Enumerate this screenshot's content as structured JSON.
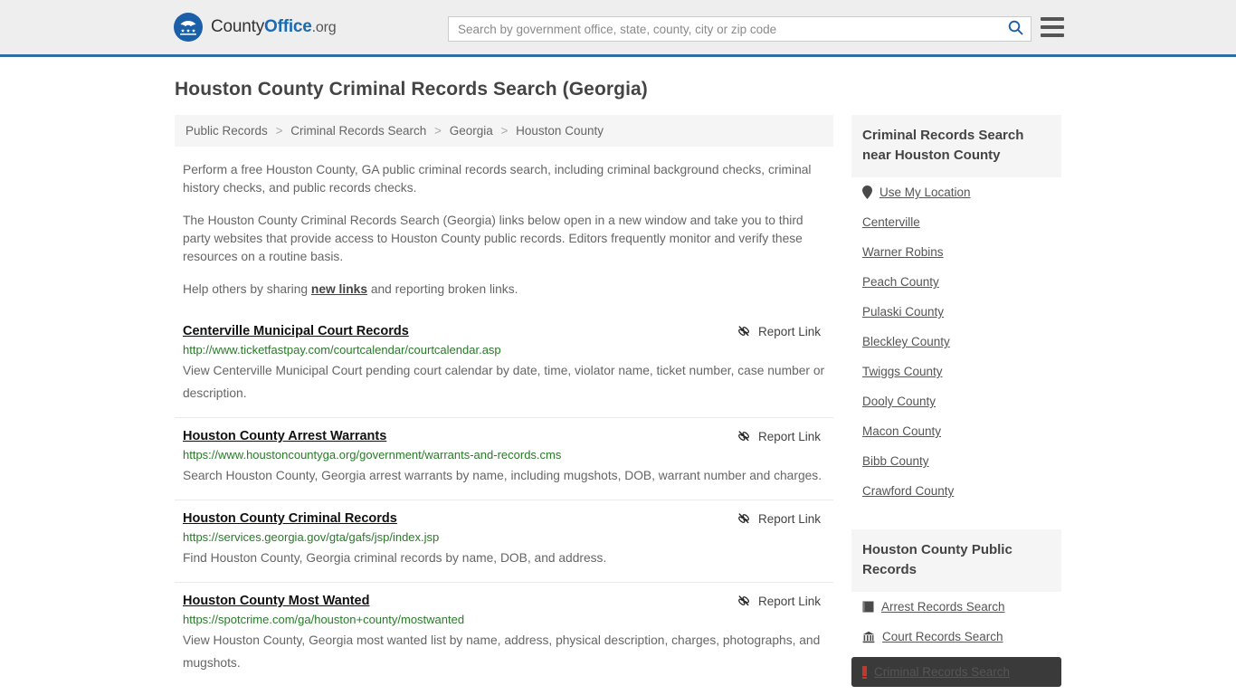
{
  "header": {
    "brand": {
      "part1": "County",
      "part2": "Office",
      "part3": ".org",
      "logo_icon": "eagle-seal-icon"
    },
    "search": {
      "placeholder": "Search by government office, state, county, city or zip code",
      "value": ""
    },
    "menu_icon": "hamburger-menu-icon",
    "search_icon": "search-icon",
    "accent_color": "#2e6da4"
  },
  "page_title": "Houston County Criminal Records Search (Georgia)",
  "breadcrumb": {
    "items": [
      "Public Records",
      "Criminal Records Search",
      "Georgia",
      "Houston County"
    ],
    "separator": ">"
  },
  "intro": {
    "p1": "Perform a free Houston County, GA public criminal records search, including criminal background checks, criminal history checks, and public records checks.",
    "p2": "The Houston County Criminal Records Search (Georgia) links below open in a new window and take you to third party websites that provide access to Houston County public records. Editors frequently monitor and verify these resources on a routine basis.",
    "p3_before": "Help others by sharing ",
    "p3_link": "new links",
    "p3_after": " and reporting broken links."
  },
  "report_link_label": "Report Link",
  "report_link_icon": "broken-link-icon",
  "results": [
    {
      "title": "Centerville Municipal Court Records",
      "url": "http://www.ticketfastpay.com/courtcalendar/courtcalendar.asp",
      "description": "View Centerville Municipal Court pending court calendar by date, time, violator name, ticket number, case number or description."
    },
    {
      "title": "Houston County Arrest Warrants",
      "url": "https://www.houstoncountyga.org/government/warrants-and-records.cms",
      "description": "Search Houston County, Georgia arrest warrants by name, including mugshots, DOB, warrant number and charges."
    },
    {
      "title": "Houston County Criminal Records",
      "url": "https://services.georgia.gov/gta/gafs/jsp/index.jsp",
      "description": "Find Houston County, Georgia criminal records by name, DOB, and address."
    },
    {
      "title": "Houston County Most Wanted",
      "url": "https://spotcrime.com/ga/houston+county/mostwanted",
      "description": "View Houston County, Georgia most wanted list by name, address, physical description, charges, photographs, and mugshots."
    }
  ],
  "sidebar": {
    "nearby": {
      "title": "Criminal Records Search near Houston County",
      "use_my_location": {
        "label": "Use My Location",
        "icon": "map-pin-icon"
      },
      "items": [
        "Centerville",
        "Warner Robins",
        "Peach County",
        "Pulaski County",
        "Bleckley County",
        "Twiggs County",
        "Dooly County",
        "Macon County",
        "Bibb County",
        "Crawford County"
      ]
    },
    "public_records": {
      "title": "Houston County Public Records",
      "items": [
        {
          "label": "Arrest Records Search",
          "icon": "notebook-icon",
          "active": false
        },
        {
          "label": "Court Records Search",
          "icon": "bank-icon",
          "active": false
        },
        {
          "label": "Criminal Records Search",
          "icon": "bar-icon",
          "active": true
        }
      ]
    }
  }
}
